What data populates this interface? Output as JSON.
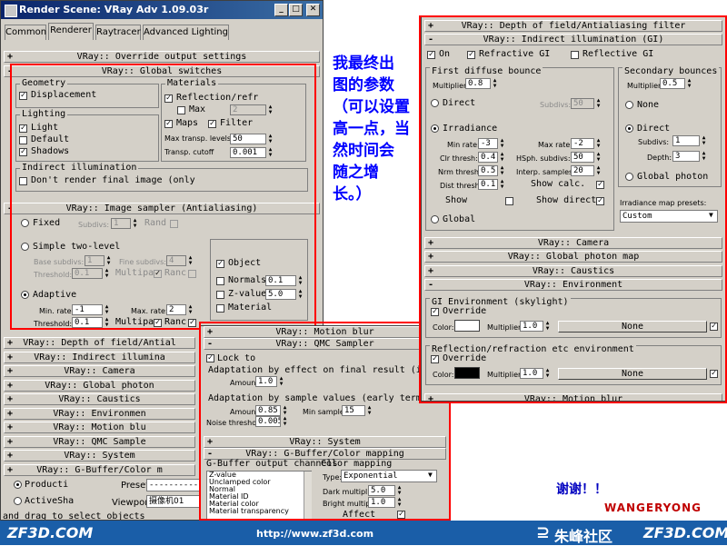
{
  "win1": {
    "title": "Render Scene: VRay Adv 1.09.03r",
    "tabs": [
      "Common",
      "Renderer",
      "Raytracer",
      "Advanced Lighting"
    ],
    "override_roll": "VRay:: Override output settings",
    "global_switches_roll": "VRay:: Global switches",
    "geometry": {
      "title": "Geometry",
      "displacement": "Displacement"
    },
    "materials": {
      "title": "Materials",
      "reflection": "Reflection/refr",
      "max": "Max",
      "max_val": "2",
      "maps": "Maps",
      "filter": "Filter",
      "max_transp_label": "Max transp. levels",
      "max_transp_val": "50",
      "transp_cutoff_label": "Transp. cutoff",
      "transp_cutoff_val": "0.001"
    },
    "lighting": {
      "title": "Lighting",
      "light": "Light",
      "default": "Default",
      "shadows": "Shadows"
    },
    "indirect": {
      "title": "Indirect illumination",
      "dont_render": "Don't render final image (only"
    },
    "image_sampler_roll": "VRay:: Image sampler (Antialiasing)",
    "sampler": {
      "fixed": "Fixed",
      "subdivs_label": "Subdivs:",
      "subdivs_val": "1",
      "rand": "Rand",
      "simple": "Simple two-level",
      "base_subdivs_label": "Base subdivs:",
      "base_subdivs_val": "1",
      "fine_subdivs_label": "Fine subdivs:",
      "fine_subdivs_val": "4",
      "threshold_label": "Threshold:",
      "threshold_val": "0.1",
      "multipa": "Multipa",
      "ranc": "Ranc",
      "adaptive": "Adaptive",
      "min_rate_label": "Min. rate:",
      "min_rate_val": "-1",
      "max_rate_label": "Max. rate:",
      "max_rate_val": "2",
      "threshold2_label": "Threshold:",
      "threshold2_val": "0.1",
      "object": "Object",
      "normals": "Normals",
      "normals_val": "0.1",
      "zvalue": "Z-value",
      "zvalue_val": "5.0",
      "material": "Material"
    },
    "collapsed_rolls": [
      "VRay:: Depth of field/Antial",
      "VRay:: Indirect illumina",
      "VRay:: Camera",
      "VRay:: Global photon",
      "VRay:: Caustics",
      "VRay:: Environmen",
      "VRay:: Motion blu",
      "VRay:: QMC Sample",
      "VRay:: System",
      "VRay:: G-Buffer/Color m"
    ],
    "bottom": {
      "production": "Producti",
      "activeshade": "ActiveSha",
      "preset_label": "Preset:",
      "preset_val": "----------",
      "viewport_label": "Viewport:",
      "viewport_val": "摄像机01",
      "status": "and drag to select objects"
    }
  },
  "win2": {
    "motion_blur_roll": "VRay:: Motion blur",
    "qmc_roll": "VRay:: QMC Sampler",
    "lock_to": "Lock to",
    "adaptation_effect": "Adaptation by effect on final result (importance samp",
    "amount_label": "Amount:",
    "amount_val": "1.0",
    "adaptation_values": "Adaptation by sample values (early termination)",
    "amount2_label": "Amount:",
    "amount2_val": "0.85",
    "min_samples_label": "Min samples:",
    "min_samples_val": "15",
    "noise_label": "Noise threshold:",
    "noise_val": "0.005",
    "system_roll": "VRay:: System",
    "gbuffer_roll": "VRay:: G-Buffer/Color mapping",
    "gbuffer_channels_title": "G-Buffer output channels",
    "channels": [
      "Z-value",
      "Unclamped color",
      "Normal",
      "Material ID",
      "Material color",
      "Material transparency"
    ],
    "color_mapping_title": "Color mapping",
    "type_label": "Type:",
    "type_val": "Exponential",
    "dark_label": "Dark multiplier:",
    "dark_val": "5.0",
    "bright_label": "Bright multiplier:",
    "bright_val": "1.0",
    "affect": "Affect"
  },
  "win3": {
    "dof_roll": "VRay:: Depth of field/Antialiasing filter",
    "gi_roll": "VRay:: Indirect illumination (GI)",
    "on": "On",
    "refractive": "Refractive GI",
    "reflective": "Reflective GI",
    "first_bounce": {
      "title": "First diffuse bounce",
      "multiplier_label": "Multiplier:",
      "multiplier_val": "0.8",
      "direct": "Direct",
      "subdivs_label": "Subdivs:",
      "subdivs_val": "50",
      "irradiance": "Irradiance",
      "min_rate_label": "Min rate:",
      "min_rate_val": "-3",
      "max_rate_label": "Max rate:",
      "max_rate_val": "-2",
      "clr_label": "Clr thresh:",
      "clr_val": "0.4",
      "hsph_label": "HSph. subdivs:",
      "hsph_val": "50",
      "nrm_label": "Nrm thresh:",
      "nrm_val": "0.5",
      "interp_label": "Interp. samples:",
      "interp_val": "20",
      "dist_label": "Dist thresh:",
      "dist_val": "0.1",
      "show_calc": "Show calc.",
      "show": "Show",
      "show_direct": "Show direct",
      "global": "Global"
    },
    "secondary": {
      "title": "Secondary bounces",
      "multiplier_label": "Multiplier:",
      "multiplier_val": "0.5",
      "none": "None",
      "direct": "Direct",
      "subdivs_label": "Subdivs:",
      "subdivs_val": "1",
      "depth_label": "Depth:",
      "depth_val": "3",
      "global_photon": "Global photon",
      "presets_label": "Irradiance map presets:",
      "presets_val": "Custom"
    },
    "camera_roll": "VRay:: Camera",
    "photon_roll": "VRay:: Global photon map",
    "caustics_roll": "VRay:: Caustics",
    "environment_roll": "VRay:: Environment",
    "gi_env": {
      "title": "GI Environment (skylight)",
      "override": "Override",
      "color_label": "Color:",
      "multiplier_label": "Multiplier:",
      "multiplier_val": "1.0",
      "map": "None"
    },
    "refl_env": {
      "title": "Reflection/refraction etc environment",
      "override": "Override",
      "color_label": "Color:",
      "multiplier_label": "Multiplier:",
      "multiplier_val": "1.0",
      "map": "None"
    },
    "motion_roll": "VRay:: Motion blur"
  },
  "annotation": [
    "我最终出",
    "图的参数",
    "（可以设置",
    "高一点，当",
    "然时间会",
    "随之增",
    "长。）"
  ],
  "thanks": "谢谢！！",
  "author": "WANGERYONG",
  "footer": {
    "left": "ZF3D.COM",
    "url": "http://www.zf3d.com",
    "brand": "朱峰社区",
    "right": "ZF3D.COM"
  },
  "colors": {
    "annotation": "#0000ff",
    "thanks": "#0000c0",
    "author": "#c00000",
    "highlight": "#ff0000"
  }
}
